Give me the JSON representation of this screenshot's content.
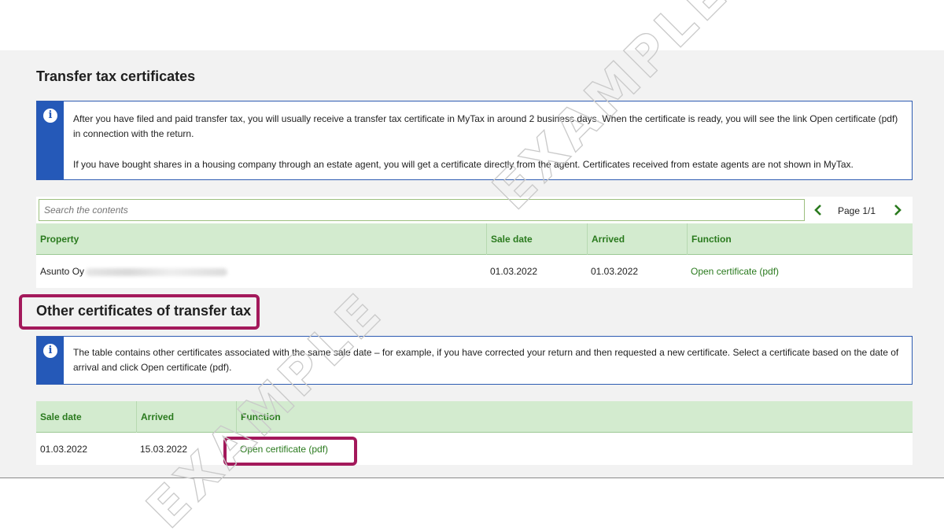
{
  "page": {
    "title": "Transfer tax certificates",
    "info": {
      "paragraph1": "After you have filed and paid transfer tax, you will usually receive a transfer tax certificate in MyTax in around 2 business days. When the certificate is ready, you will see the link Open certificate (pdf) in connection with the return.",
      "paragraph2": "If you have bought shares in a housing company through an estate agent, you will get a certificate directly from the agent. Certificates received from estate agents are not shown in MyTax."
    },
    "search": {
      "placeholder": "Search the contents"
    },
    "pager": {
      "label": "Page 1/1",
      "prev_icon": "chevron-left-icon",
      "next_icon": "chevron-right-icon"
    },
    "table": {
      "columns": [
        "Property",
        "Sale date",
        "Arrived",
        "Function"
      ],
      "rows": [
        {
          "property": "Asunto Oy",
          "sale_date": "01.03.2022",
          "arrived": "01.03.2022",
          "function": "Open certificate (pdf)"
        }
      ]
    }
  },
  "other": {
    "title": "Other certificates of transfer tax",
    "info": "The table contains other certificates associated with the same sale date – for example, if you have corrected your return and then requested a new certificate. Select a certificate based on the date of arrival and click Open certificate (pdf).",
    "table": {
      "columns": [
        "Sale date",
        "Arrived",
        "Function"
      ],
      "rows": [
        {
          "sale_date": "01.03.2022",
          "arrived": "15.03.2022",
          "function": "Open certificate (pdf)"
        }
      ]
    }
  },
  "watermark": "EXAMPLE",
  "colors": {
    "accent_green": "#2a7a1e",
    "header_green": "#d3ebcf",
    "info_blue": "#2559b8",
    "highlight": "#a3195b"
  }
}
